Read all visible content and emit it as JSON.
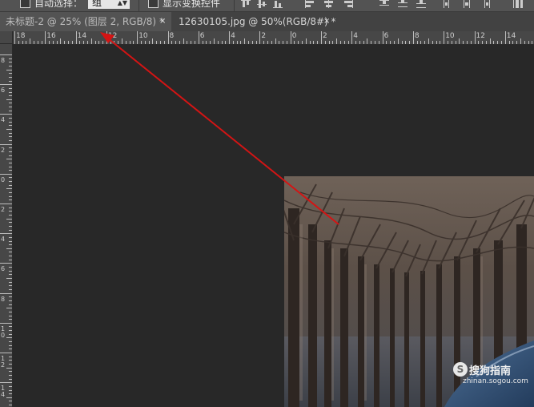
{
  "options_bar": {
    "auto_select_label": "自动选择：",
    "auto_select_value": "组",
    "show_transform_label": "显示变换控件"
  },
  "tabs": [
    {
      "title": "未标题-2 @ 25% (图层 2, RGB/8) *",
      "close": "×",
      "active": true
    },
    {
      "title": "12630105.jpg @ 50%(RGB/8#) *",
      "close": "×",
      "active": false
    }
  ],
  "ruler": {
    "horizontal_labels": [
      "18",
      "16",
      "14",
      "12",
      "10",
      "8",
      "6",
      "4",
      "2",
      "0",
      "2",
      "4",
      "6",
      "8",
      "10",
      "12",
      "14"
    ],
    "vertical_labels": [
      "8",
      "6",
      "4",
      "2",
      "0",
      "2",
      "4",
      "6",
      "8",
      "1\n0",
      "1\n2",
      "1\n4"
    ]
  },
  "watermark": {
    "logo": "S",
    "text": "搜狗指南",
    "sub": "zhinan.sogou.com"
  },
  "colors": {
    "annotation_arrow": "#d41414",
    "canvas_bg": "#282828",
    "panel_bg": "#535353"
  },
  "icons": [
    "align-top-icon",
    "align-vcenter-icon",
    "align-bottom-icon",
    "align-left-icon",
    "align-hcenter-icon",
    "align-right-icon",
    "distribute-icon"
  ]
}
